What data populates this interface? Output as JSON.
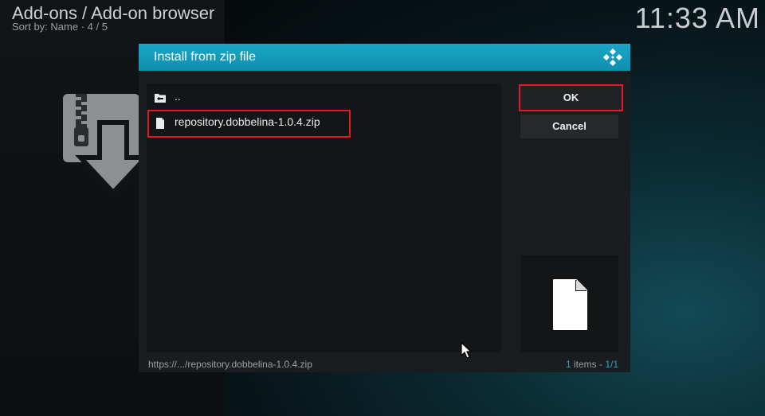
{
  "header": {
    "breadcrumb": "Add-ons / Add-on browser",
    "sort_info": "Sort by: Name  ·  4 / 5",
    "clock": "11:33 AM"
  },
  "dialog": {
    "title": "Install from zip file",
    "items": [
      {
        "label": "..",
        "icon": "parent-folder-icon"
      },
      {
        "label": "repository.dobbelina-1.0.4.zip",
        "icon": "file-icon"
      }
    ],
    "buttons": {
      "ok": "OK",
      "cancel": "Cancel"
    },
    "footer_path": "https://.../repository.dobbelina-1.0.4.zip",
    "footer_count_num": "1",
    "footer_count_text": " items - ",
    "footer_page": "1/1"
  },
  "colors": {
    "accent": "#12a1c1",
    "highlight": "#e01b24",
    "link_blue": "#22a8cf"
  }
}
